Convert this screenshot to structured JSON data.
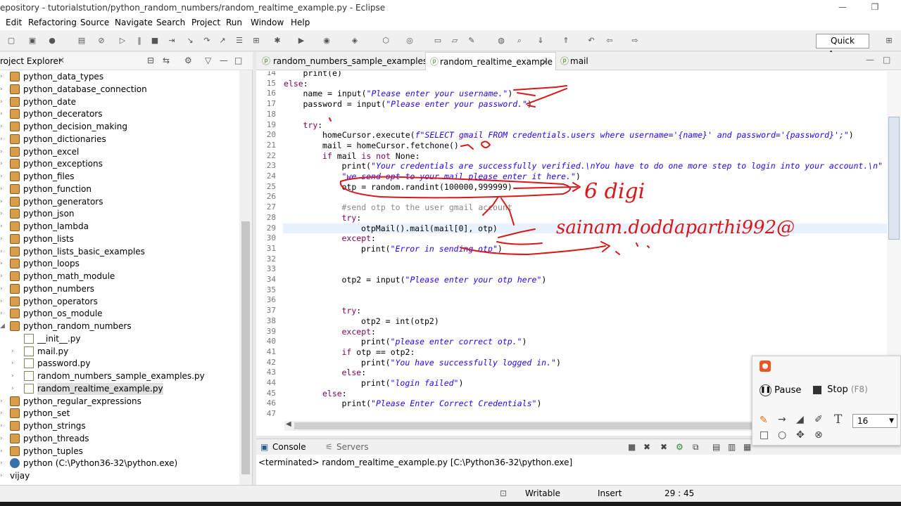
{
  "window": {
    "title": "epository - tutorialstution/python_random_numbers/random_realtime_example.py - Eclipse",
    "minimize": "—",
    "restore": "❐"
  },
  "menu": [
    "Edit",
    "Refactoring",
    "Source",
    "Navigate",
    "Search",
    "Project",
    "Run",
    "Window",
    "Help"
  ],
  "toolbar": {
    "quick_access": "Quick Access"
  },
  "project_explorer": {
    "title": "roject Explorer",
    "items": [
      {
        "label": "python_data_types",
        "type": "package"
      },
      {
        "label": "python_database_connection",
        "type": "package"
      },
      {
        "label": "python_date",
        "type": "package"
      },
      {
        "label": "python_decerators",
        "type": "package"
      },
      {
        "label": "python_decision_making",
        "type": "package"
      },
      {
        "label": "python_dictionaries",
        "type": "package"
      },
      {
        "label": "python_excel",
        "type": "package"
      },
      {
        "label": "python_exceptions",
        "type": "package"
      },
      {
        "label": "python_files",
        "type": "package"
      },
      {
        "label": "python_function",
        "type": "package"
      },
      {
        "label": "python_generators",
        "type": "package"
      },
      {
        "label": "python_json",
        "type": "package"
      },
      {
        "label": "python_lambda",
        "type": "package"
      },
      {
        "label": "python_lists",
        "type": "package"
      },
      {
        "label": "python_lists_basic_examples",
        "type": "package"
      },
      {
        "label": "python_loops",
        "type": "package"
      },
      {
        "label": "python_math_module",
        "type": "package"
      },
      {
        "label": "python_numbers",
        "type": "package"
      },
      {
        "label": "python_operators",
        "type": "package"
      },
      {
        "label": "python_os_module",
        "type": "package"
      },
      {
        "label": "python_random_numbers",
        "type": "package"
      },
      {
        "label": "__init__.py",
        "type": "file"
      },
      {
        "label": "mail.py",
        "type": "file"
      },
      {
        "label": "password.py",
        "type": "file"
      },
      {
        "label": "random_numbers_sample_examples.py",
        "type": "file"
      },
      {
        "label": "random_realtime_example.py",
        "type": "file"
      },
      {
        "label": "python_regular_expressions",
        "type": "package"
      },
      {
        "label": "python_set",
        "type": "package"
      },
      {
        "label": "python_strings",
        "type": "package"
      },
      {
        "label": "python_threads",
        "type": "package"
      },
      {
        "label": "python_tuples",
        "type": "package"
      },
      {
        "label": "python  (C:\\Python36-32\\python.exe)",
        "type": "interpreter"
      },
      {
        "label": "vijay",
        "type": "project"
      }
    ]
  },
  "editor": {
    "tabs": [
      {
        "label": "random_numbers_sample_examples"
      },
      {
        "label": "random_realtime_example",
        "active": true
      },
      {
        "label": "mail"
      }
    ],
    "lines": [
      {
        "n": "14",
        "indent": 1,
        "parts": [
          [
            "",
            "print(e)"
          ]
        ]
      },
      {
        "n": "15",
        "indent": 0,
        "parts": [
          [
            "kw",
            "else"
          ],
          [
            "",
            ":"
          ]
        ]
      },
      {
        "n": "16",
        "indent": 1,
        "parts": [
          [
            "",
            "name = input("
          ],
          [
            "s",
            "\"Please enter your username.\""
          ],
          [
            "",
            ")"
          ]
        ]
      },
      {
        "n": "17",
        "indent": 1,
        "parts": [
          [
            "",
            "password = input("
          ],
          [
            "s",
            "\"Please enter your password.\""
          ],
          [
            "",
            ")"
          ]
        ]
      },
      {
        "n": "18",
        "indent": 0,
        "parts": []
      },
      {
        "n": "19",
        "indent": 1,
        "parts": [
          [
            "kw",
            "try"
          ],
          [
            "",
            ":"
          ]
        ]
      },
      {
        "n": "20",
        "indent": 2,
        "parts": [
          [
            "",
            "homeCursor.execute("
          ],
          [
            "s",
            "f\"SELECT gmail FROM credentials.users where username='{name}' and password='{password}';\""
          ],
          [
            "",
            ")"
          ]
        ]
      },
      {
        "n": "21",
        "indent": 2,
        "parts": [
          [
            "",
            "mail = homeCursor.fetchone()"
          ]
        ]
      },
      {
        "n": "22",
        "indent": 2,
        "parts": [
          [
            "kw",
            "if"
          ],
          [
            "",
            " mail "
          ],
          [
            "kw",
            "is not"
          ],
          [
            "",
            " None:"
          ]
        ]
      },
      {
        "n": "23",
        "indent": 3,
        "parts": [
          [
            "",
            "print("
          ],
          [
            "s",
            "\"Your credentials are successfully verified.\\nYou have to do one more step to login into your account.\\n\""
          ]
        ]
      },
      {
        "n": "24",
        "indent": 3,
        "parts": [
          [
            "s",
            "\"we send opt to your mail please enter it here.\""
          ],
          [
            "",
            ")"
          ]
        ]
      },
      {
        "n": "25",
        "indent": 3,
        "parts": [
          [
            "",
            "otp = random.randint(100000,999999)"
          ]
        ]
      },
      {
        "n": "26",
        "indent": 0,
        "parts": []
      },
      {
        "n": "27",
        "indent": 3,
        "parts": [
          [
            "cm",
            "#send otp to the user gmail account"
          ]
        ]
      },
      {
        "n": "28",
        "indent": 3,
        "parts": [
          [
            "kw",
            "try"
          ],
          [
            "",
            ":"
          ]
        ]
      },
      {
        "n": "29",
        "indent": 4,
        "parts": [
          [
            "",
            "otpMail().mail(mail[0], otp)"
          ]
        ],
        "current": true
      },
      {
        "n": "30",
        "indent": 3,
        "parts": [
          [
            "kw",
            "except"
          ],
          [
            "",
            ":"
          ]
        ]
      },
      {
        "n": "31",
        "indent": 4,
        "parts": [
          [
            "",
            "print("
          ],
          [
            "s",
            "\"Error in sending otp\""
          ],
          [
            "",
            ")"
          ]
        ]
      },
      {
        "n": "32",
        "indent": 0,
        "parts": []
      },
      {
        "n": "33",
        "indent": 0,
        "parts": []
      },
      {
        "n": "34",
        "indent": 3,
        "parts": [
          [
            "",
            "otp2 = input("
          ],
          [
            "s",
            "\"Please enter your otp here\""
          ],
          [
            "",
            ")"
          ]
        ]
      },
      {
        "n": "35",
        "indent": 0,
        "parts": []
      },
      {
        "n": "36",
        "indent": 0,
        "parts": []
      },
      {
        "n": "37",
        "indent": 3,
        "parts": [
          [
            "kw",
            "try"
          ],
          [
            "",
            ":"
          ]
        ]
      },
      {
        "n": "38",
        "indent": 4,
        "parts": [
          [
            "",
            "otp2 = int(otp2)"
          ]
        ]
      },
      {
        "n": "39",
        "indent": 3,
        "parts": [
          [
            "kw",
            "except"
          ],
          [
            "",
            ":"
          ]
        ]
      },
      {
        "n": "40",
        "indent": 4,
        "parts": [
          [
            "",
            "print("
          ],
          [
            "s",
            "\"please enter correct otp.\""
          ],
          [
            "",
            ")"
          ]
        ]
      },
      {
        "n": "41",
        "indent": 3,
        "parts": [
          [
            "kw",
            "if"
          ],
          [
            "",
            " otp == otp2:"
          ]
        ]
      },
      {
        "n": "42",
        "indent": 4,
        "parts": [
          [
            "",
            "print("
          ],
          [
            "s",
            "\"You have successfully logged in.\""
          ],
          [
            "",
            ")"
          ]
        ]
      },
      {
        "n": "43",
        "indent": 3,
        "parts": [
          [
            "kw",
            "else"
          ],
          [
            "",
            ":"
          ]
        ]
      },
      {
        "n": "44",
        "indent": 4,
        "parts": [
          [
            "",
            "print("
          ],
          [
            "s",
            "\"login failed\""
          ],
          [
            "",
            ")"
          ]
        ]
      },
      {
        "n": "45",
        "indent": 2,
        "parts": [
          [
            "kw",
            "else"
          ],
          [
            "",
            ":"
          ]
        ]
      },
      {
        "n": "46",
        "indent": 3,
        "parts": [
          [
            "",
            "print("
          ],
          [
            "s",
            "\"Please Enter Correct Credentials\""
          ],
          [
            "",
            ")"
          ]
        ]
      },
      {
        "n": "47",
        "indent": 0,
        "parts": []
      }
    ]
  },
  "console": {
    "tabs": [
      "Console",
      "Servers"
    ],
    "text": "<terminated> random_realtime_example.py [C:\\Python36-32\\python.exe]"
  },
  "status": {
    "writable": "Writable",
    "insert": "Insert",
    "position": "29 : 45"
  },
  "recorder": {
    "pause": "Pause",
    "stop": "Stop",
    "stop_key": "(F8)",
    "size": "16"
  },
  "annotations": {
    "digits_note": "6 digi",
    "email_note": "sainam.doddaparthi992@",
    "ink_color": "#d81818"
  }
}
